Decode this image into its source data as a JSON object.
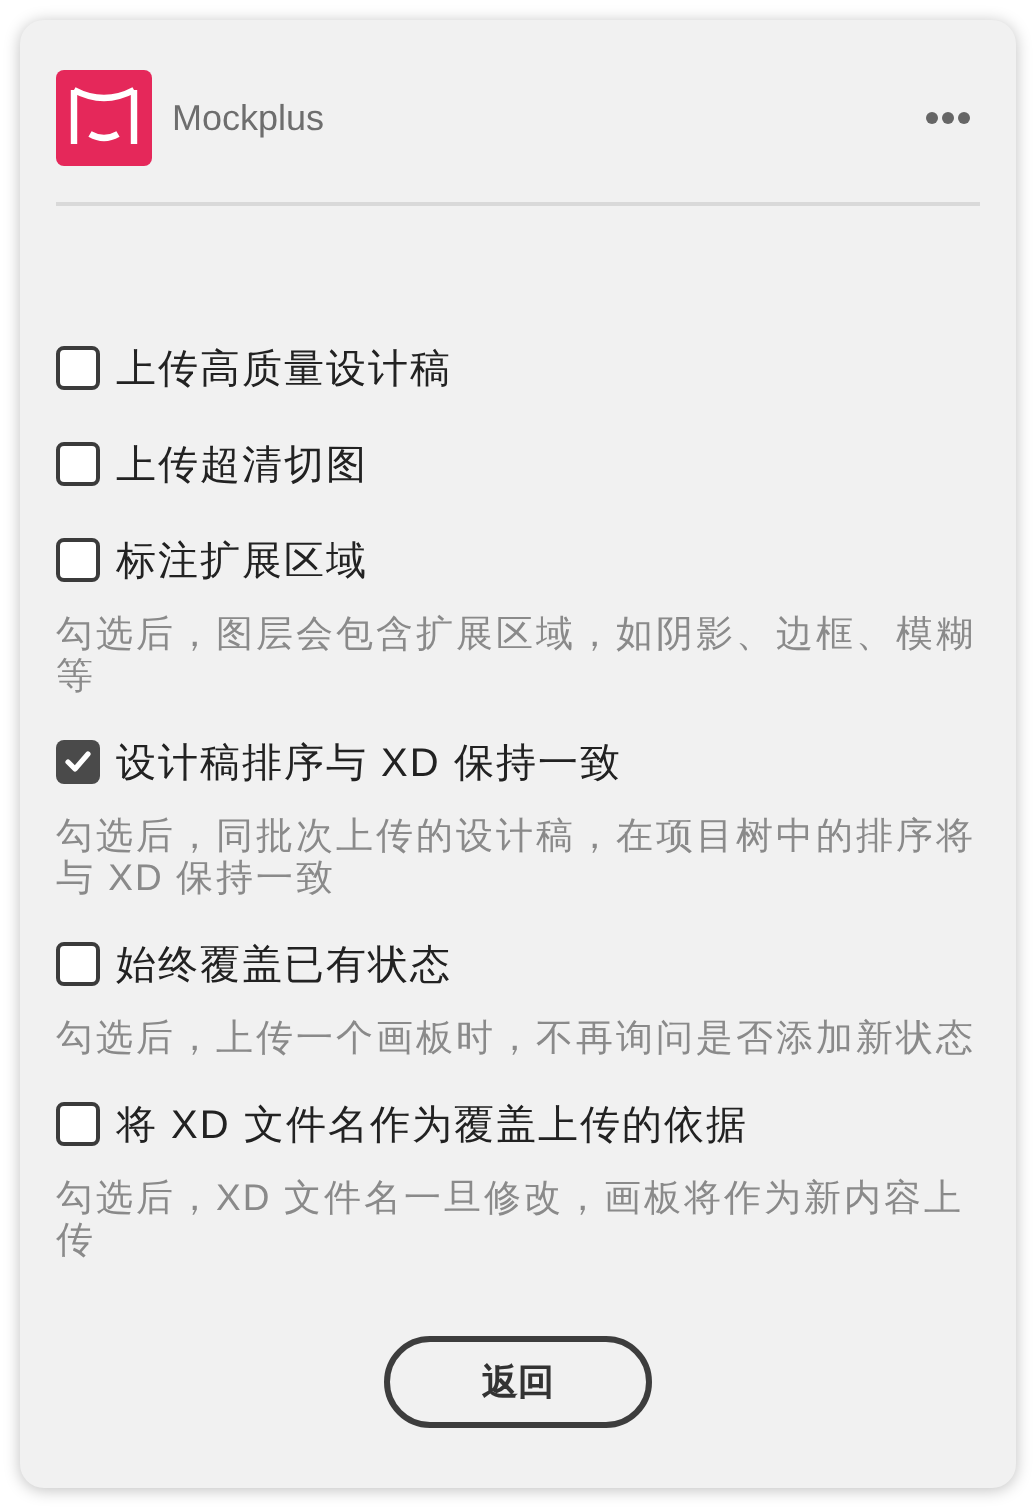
{
  "header": {
    "app_name": "Mockplus"
  },
  "options": [
    {
      "label": "上传高质量设计稿",
      "checked": false
    },
    {
      "label": "上传超清切图",
      "checked": false
    },
    {
      "label": "标注扩展区域",
      "checked": false,
      "description": "勾选后，图层会包含扩展区域，如阴影、边框、模糊等"
    },
    {
      "label": "设计稿排序与 XD 保持一致",
      "checked": true,
      "description": "勾选后，同批次上传的设计稿，在项目树中的排序将与 XD 保持一致"
    },
    {
      "label": "始终覆盖已有状态",
      "checked": false,
      "description": "勾选后，上传一个画板时，不再询问是否添加新状态"
    },
    {
      "label": "将 XD 文件名作为覆盖上传的依据",
      "checked": false,
      "description": "勾选后，XD 文件名一旦修改，画板将作为新内容上传"
    }
  ],
  "back_button": "返回"
}
